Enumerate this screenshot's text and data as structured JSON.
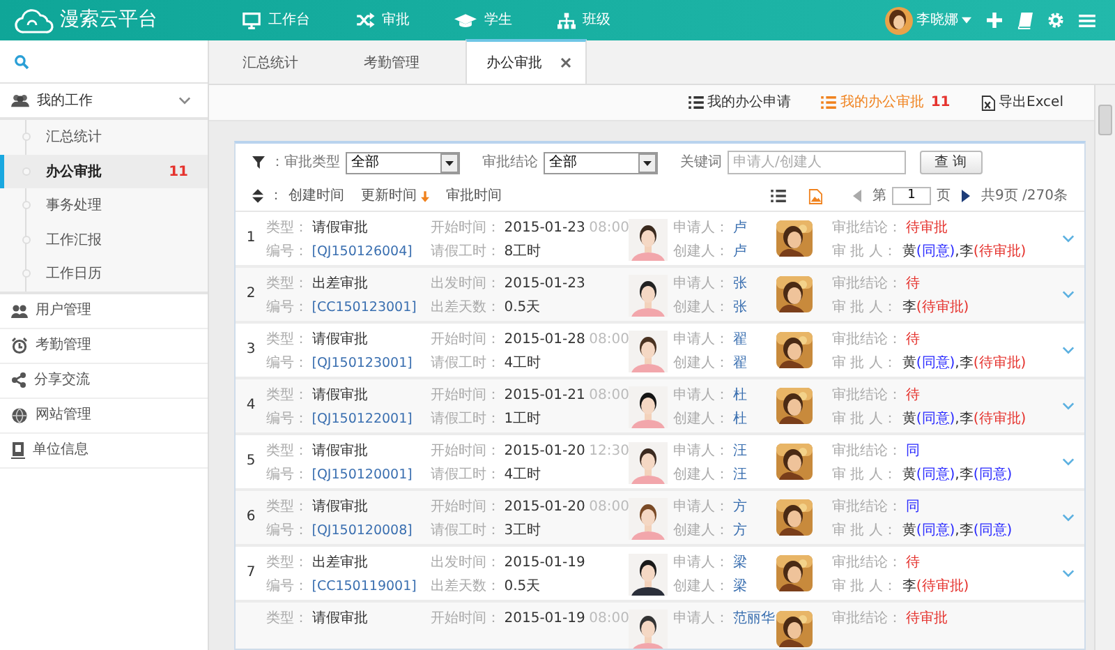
{
  "brand": {
    "name": "漫索云平台"
  },
  "top_nav": [
    {
      "label": "工作台"
    },
    {
      "label": "审批"
    },
    {
      "label": "学生"
    },
    {
      "label": "班级"
    }
  ],
  "user": {
    "name": "李晓娜"
  },
  "sidebar": [
    {
      "label": "我的工作",
      "expanded": true,
      "children": [
        {
          "label": "汇总统计",
          "selected": false
        },
        {
          "label": "办公审批",
          "selected": true,
          "badge": "11"
        },
        {
          "label": "事务处理",
          "selected": false
        },
        {
          "label": "工作汇报",
          "selected": false
        },
        {
          "label": "工作日历",
          "selected": false
        }
      ]
    },
    {
      "label": "用户管理"
    },
    {
      "label": "考勤管理"
    },
    {
      "label": "分享交流"
    },
    {
      "label": "网站管理"
    },
    {
      "label": "单位信息"
    }
  ],
  "tabs": [
    {
      "label": "汇总统计",
      "selected": false
    },
    {
      "label": "考勤管理",
      "selected": false
    },
    {
      "label": "办公审批",
      "selected": true,
      "closable": true
    }
  ],
  "actions": [
    {
      "label": "我的办公申请",
      "selected": false
    },
    {
      "label": "我的办公审批",
      "selected": true,
      "badge": "11"
    },
    {
      "label": "导出Excel",
      "selected": false
    }
  ],
  "filters": {
    "prefix": "：",
    "type": {
      "label": "审批类型",
      "value": "全部"
    },
    "conclusion": {
      "label": "审批结论",
      "value": "全部"
    },
    "keyword": {
      "label": "关键词",
      "placeholder": "申请人/创建人"
    },
    "button": "查 询"
  },
  "sort": {
    "prefix": "：",
    "options": [
      {
        "label": "创建时间",
        "selected": false
      },
      {
        "label": "更新时间",
        "selected": true
      },
      {
        "label": "审批时间",
        "selected": false
      }
    ]
  },
  "views": [
    {
      "selected": false
    },
    {
      "selected": true
    }
  ],
  "pager": {
    "prefix": "第",
    "page": "1",
    "suffix": "页",
    "total": "共9页 /270条"
  },
  "rows": [
    {
      "index": "1",
      "type": [
        "类型：",
        "请假审批"
      ],
      "code": [
        "编号：",
        "[QJ150126004]"
      ],
      "start": [
        "开始时间：",
        "2015-01-23",
        "08:00"
      ],
      "amount": [
        "请假工时：",
        "8工时"
      ],
      "applicant": [
        "申请人：",
        "卢"
      ],
      "creator": [
        "创建人：",
        "卢"
      ],
      "conclusion": [
        "审批结论：",
        "待审批"
      ],
      "pending": true,
      "approvers_label": "审 批 人：",
      "approvers": [
        {
          "name": "黄",
          "result": "(同意)",
          "pending": false
        },
        {
          "name": ",李",
          "result": "(待审批)",
          "pending": true
        }
      ],
      "expanded": false
    },
    {
      "index": "2",
      "type": [
        "类型：",
        "出差审批"
      ],
      "code": [
        "编号：",
        "[CC150123001]"
      ],
      "start": [
        "出发时间：",
        "2015-01-23"
      ],
      "amount": [
        "出差天数：",
        "0.5天"
      ],
      "applicant": [
        "申请人：",
        "张"
      ],
      "creator": [
        "创建人：",
        "张"
      ],
      "conclusion": [
        "审批结论：",
        "待"
      ],
      "pending": true,
      "approvers_label": "审 批 人：",
      "approvers": [
        {
          "name": "李",
          "result": "(待审批)",
          "pending": true
        }
      ],
      "expanded": false
    },
    {
      "index": "3",
      "type": [
        "类型：",
        "请假审批"
      ],
      "code": [
        "编号：",
        "[QJ150123001]"
      ],
      "start": [
        "开始时间：",
        "2015-01-28",
        "08:00"
      ],
      "amount": [
        "请假工时：",
        "4工时"
      ],
      "applicant": [
        "申请人：",
        "翟"
      ],
      "creator": [
        "创建人：",
        "翟"
      ],
      "conclusion": [
        "审批结论：",
        "待"
      ],
      "pending": true,
      "approvers_label": "审 批 人：",
      "approvers": [
        {
          "name": "黄",
          "result": "(同意)",
          "pending": false
        },
        {
          "name": ",李",
          "result": "(待审批)",
          "pending": true
        }
      ],
      "expanded": false
    },
    {
      "index": "4",
      "type": [
        "类型：",
        "请假审批"
      ],
      "code": [
        "编号：",
        "[QJ150122001]"
      ],
      "start": [
        "开始时间：",
        "2015-01-21",
        "08:00"
      ],
      "amount": [
        "请假工时：",
        "1工时"
      ],
      "applicant": [
        "申请人：",
        "杜"
      ],
      "creator": [
        "创建人：",
        "杜"
      ],
      "conclusion": [
        "审批结论：",
        "待"
      ],
      "pending": true,
      "approvers_label": "审 批 人：",
      "approvers": [
        {
          "name": "黄",
          "result": "(同意)",
          "pending": false
        },
        {
          "name": ",李",
          "result": "(待审批)",
          "pending": true
        }
      ],
      "expanded": false
    },
    {
      "index": "5",
      "type": [
        "类型：",
        "请假审批"
      ],
      "code": [
        "编号：",
        "[QJ150120001]"
      ],
      "start": [
        "开始时间：",
        "2015-01-20",
        "12:30"
      ],
      "amount": [
        "请假工时：",
        "4工时"
      ],
      "applicant": [
        "申请人：",
        "汪"
      ],
      "creator": [
        "创建人：",
        "汪"
      ],
      "conclusion": [
        "审批结论：",
        "同"
      ],
      "pending": false,
      "approvers_label": "审 批 人：",
      "approvers": [
        {
          "name": "黄",
          "result": "(同意)",
          "pending": false
        },
        {
          "name": ",李",
          "result": "(同意)",
          "pending": false
        }
      ],
      "expanded": false
    },
    {
      "index": "6",
      "type": [
        "类型：",
        "请假审批"
      ],
      "code": [
        "编号：",
        "[QJ150120008]"
      ],
      "start": [
        "开始时间：",
        "2015-01-20",
        "08:00"
      ],
      "amount": [
        "请假工时：",
        "3工时"
      ],
      "applicant": [
        "申请人：",
        "方"
      ],
      "creator": [
        "创建人：",
        "方"
      ],
      "conclusion": [
        "审批结论：",
        "同"
      ],
      "pending": false,
      "approvers_label": "审 批 人：",
      "approvers": [
        {
          "name": "黄",
          "result": "(同意)",
          "pending": false
        },
        {
          "name": ",李",
          "result": "(同意)",
          "pending": false
        }
      ],
      "expanded": false
    },
    {
      "index": "7",
      "type": [
        "类型：",
        "出差审批"
      ],
      "code": [
        "编号：",
        "[CC150119001]"
      ],
      "start": [
        "出发时间：",
        "2015-01-19"
      ],
      "amount": [
        "出差天数：",
        "0.5天"
      ],
      "applicant": [
        "申请人：",
        "梁"
      ],
      "creator": [
        "创建人：",
        "梁"
      ],
      "conclusion": [
        "审批结论：",
        "待"
      ],
      "pending": true,
      "approvers_label": "审 批 人：",
      "approvers": [
        {
          "name": "李",
          "result": "(待审批)",
          "pending": true
        }
      ],
      "expanded": false
    },
    {
      "type": [
        "类型：",
        "请假审批"
      ],
      "start": [
        "开始时间：",
        "2015-01-19",
        "08:00"
      ],
      "applicant": [
        "申请人：",
        "范丽华"
      ],
      "conclusion": [
        "审批结论：",
        "待审批"
      ],
      "pending": true
    }
  ]
}
